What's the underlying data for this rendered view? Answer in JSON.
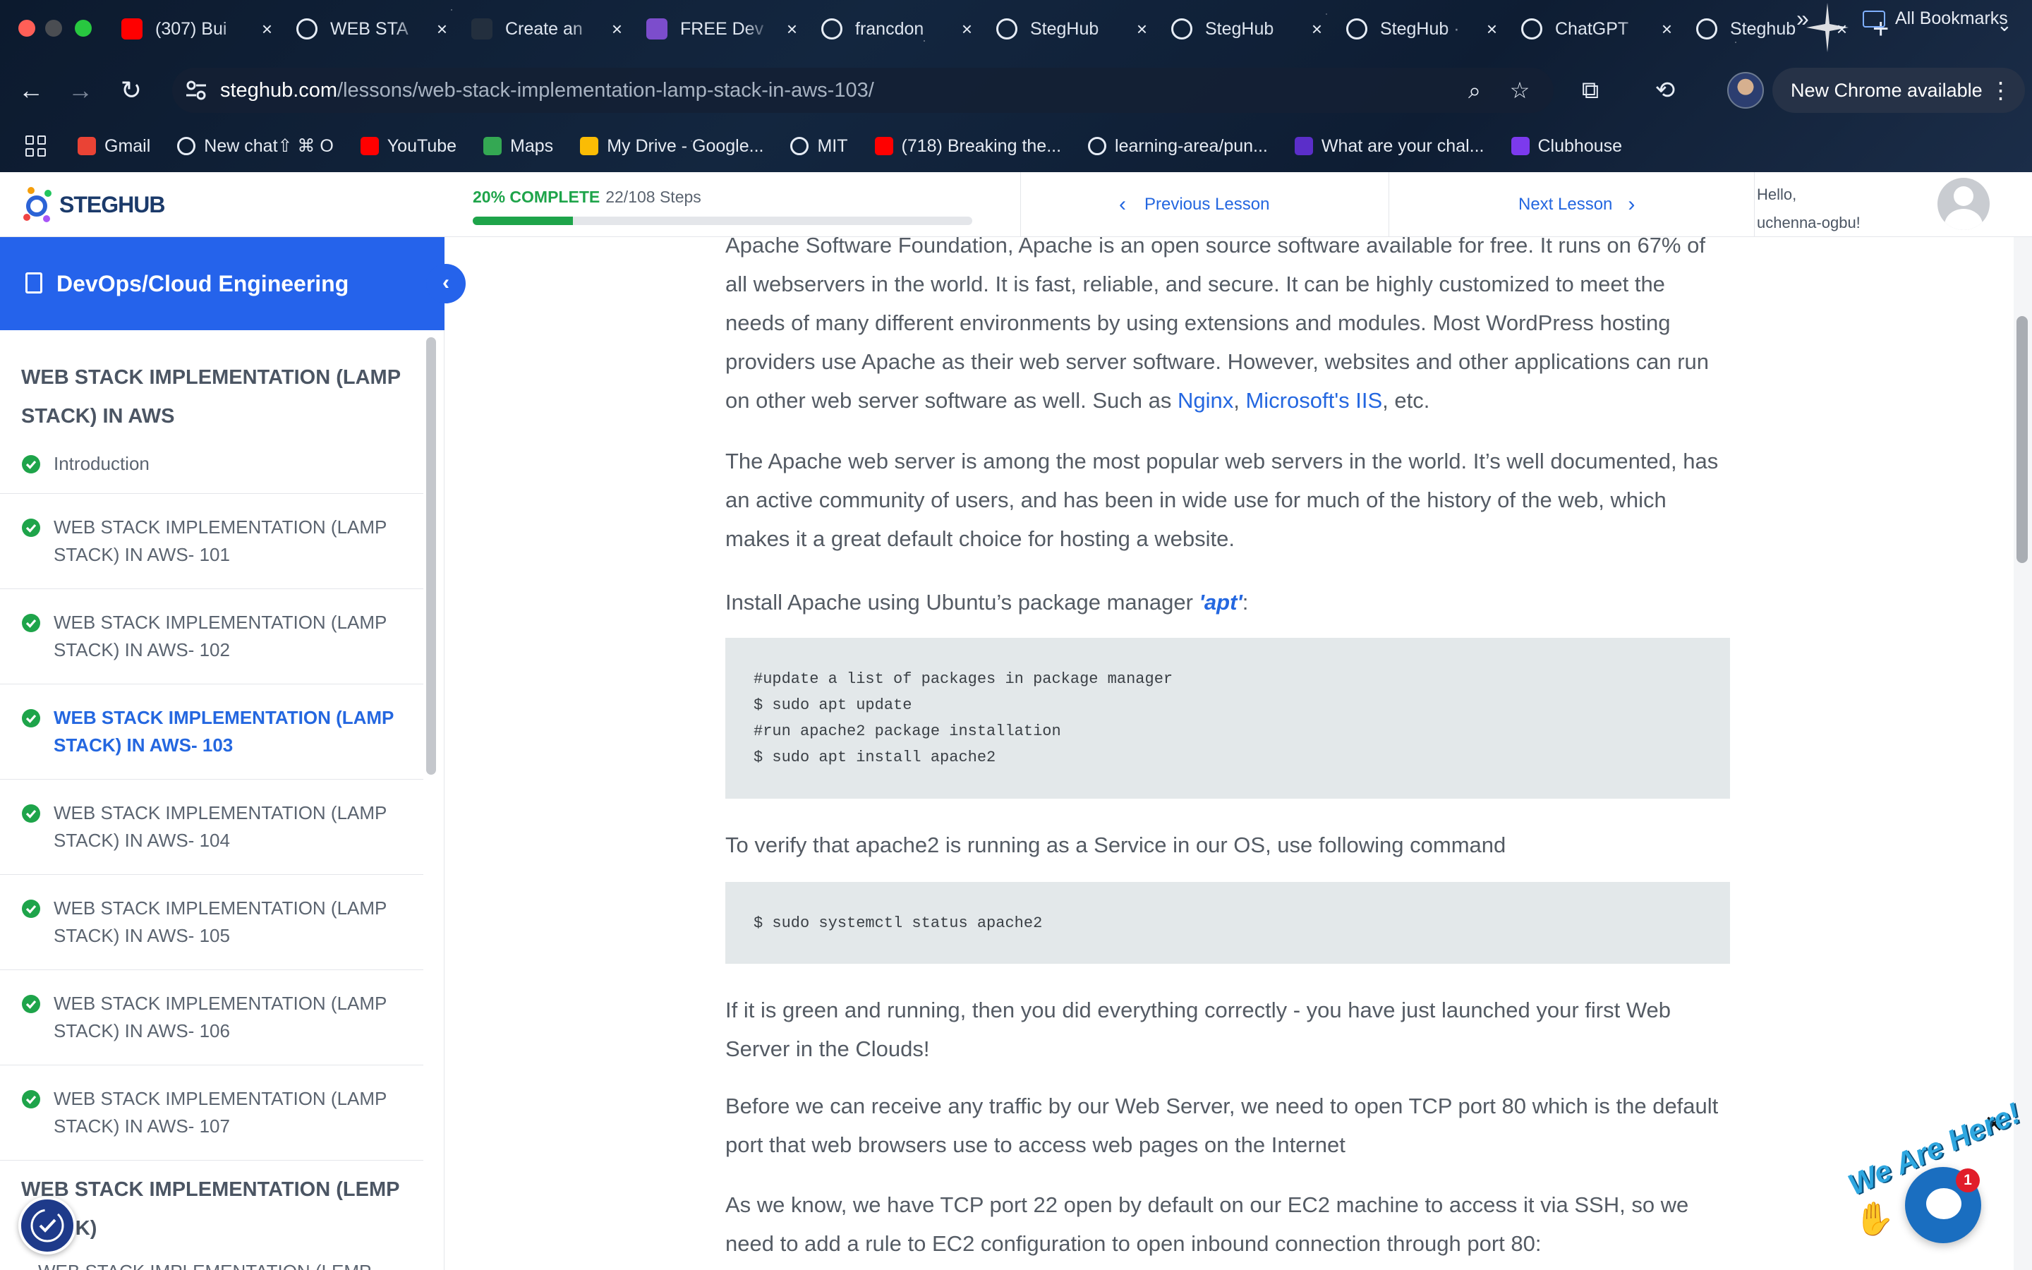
{
  "browser": {
    "tabs": [
      {
        "title": "(307) Bui",
        "icon": "youtube-icon",
        "color": "#ff0000"
      },
      {
        "title": "WEB STA",
        "icon": "steghub-icon",
        "color": "#ffffff"
      },
      {
        "title": "Create an",
        "icon": "aws-icon",
        "color": "#232f3e"
      },
      {
        "title": "FREE Dev",
        "icon": "forms-icon",
        "color": "#7c4dcc"
      },
      {
        "title": "francdon",
        "icon": "github-icon",
        "color": "#ffffff"
      },
      {
        "title": "StegHub",
        "icon": "github-icon",
        "color": "#ffffff"
      },
      {
        "title": "StegHub",
        "icon": "github-icon",
        "color": "#ffffff"
      },
      {
        "title": "StegHub ·",
        "icon": "globe-icon",
        "color": "#ffffff"
      },
      {
        "title": "ChatGPT",
        "icon": "chatgpt-icon",
        "color": "#ffffff"
      },
      {
        "title": "Steghub",
        "icon": "github-icon",
        "color": "#ffffff"
      }
    ],
    "url_domain": "steghub.com",
    "url_path": "/lessons/web-stack-implementation-lamp-stack-in-aws-103/",
    "update_label": "New Chrome available",
    "bookmarks": [
      {
        "label": "Gmail",
        "icon": "gmail-icon",
        "color": "#ea4335"
      },
      {
        "label": "New chat⇧ ⌘ O",
        "icon": "chatgpt-icon",
        "color": "#ffffff"
      },
      {
        "label": "YouTube",
        "icon": "youtube-icon",
        "color": "#ff0000"
      },
      {
        "label": "Maps",
        "icon": "maps-icon",
        "color": "#34a853"
      },
      {
        "label": "My Drive - Google...",
        "icon": "drive-icon",
        "color": "#fbbc04"
      },
      {
        "label": "MIT",
        "icon": "globe-icon",
        "color": "#ffffff"
      },
      {
        "label": "(718) Breaking the...",
        "icon": "youtube-icon",
        "color": "#ff0000"
      },
      {
        "label": "learning-area/pun...",
        "icon": "github-icon",
        "color": "#ffffff"
      },
      {
        "label": "What are your chal...",
        "icon": "bookmark-icon",
        "color": "#5b2ec9"
      },
      {
        "label": "Clubhouse",
        "icon": "clubhouse-icon",
        "color": "#7c3aed"
      }
    ],
    "all_bookmarks_label": "All Bookmarks"
  },
  "header": {
    "logo_text": "STEGHUB",
    "progress_percent_label": "20% COMPLETE",
    "progress_steps": "22/108 Steps",
    "progress_fraction": 0.2,
    "prev_label": "Previous Lesson",
    "next_label": "Next Lesson",
    "greeting": "Hello, uchenna-ogbu!"
  },
  "sidebar": {
    "course_title": "DevOps/Cloud Engineering",
    "sections": [
      {
        "title": "WEB STACK IMPLEMENTATION (LAMP STACK) IN AWS",
        "lessons": [
          {
            "label": "Introduction",
            "done": true,
            "active": false
          },
          {
            "label": "WEB STACK IMPLEMENTATION (LAMP STACK) IN AWS- 101",
            "done": true,
            "active": false
          },
          {
            "label": "WEB STACK IMPLEMENTATION (LAMP STACK) IN AWS- 102",
            "done": true,
            "active": false
          },
          {
            "label": "WEB STACK IMPLEMENTATION (LAMP STACK) IN AWS- 103",
            "done": true,
            "active": true
          },
          {
            "label": "WEB STACK IMPLEMENTATION (LAMP STACK) IN AWS- 104",
            "done": true,
            "active": false
          },
          {
            "label": "WEB STACK IMPLEMENTATION (LAMP STACK) IN AWS- 105",
            "done": true,
            "active": false
          },
          {
            "label": "WEB STACK IMPLEMENTATION (LAMP STACK) IN AWS- 106",
            "done": true,
            "active": false
          },
          {
            "label": "WEB STACK IMPLEMENTATION (LAMP STACK) IN AWS- 107",
            "done": true,
            "active": false
          }
        ]
      },
      {
        "title": "WEB STACK IMPLEMENTATION (LEMP STACK)",
        "lessons": [
          {
            "label": "WEB STACK IMPLEMENTATION (LEMP",
            "done": false,
            "active": false
          }
        ]
      }
    ]
  },
  "content": {
    "p1_text": "Apache Software Foundation, Apache is an open source software available for free. It runs on 67% of all webservers in the world. It is fast, reliable, and secure. It can be highly customized to meet the needs of many different environments by using extensions and modules. Most WordPress hosting providers use Apache as their web server software. However, websites and other applications can run on other web server software as well. Such as ",
    "p1_link1": "Nginx",
    "p1_sep": ", ",
    "p1_link2": "Microsoft's IIS",
    "p1_end": ", etc.",
    "p2": "The Apache web server is among the most popular web servers in the world. It’s well documented, has an active community of users, and has been in wide use for much of the history of the web, which makes it a great default choice for hosting a website.",
    "p3_text": "Install Apache using Ubuntu’s package manager ",
    "p3_code": "'apt'",
    "p3_end": ":",
    "code1": "#update a list of packages in package manager\n$ sudo apt update\n#run apache2 package installation\n$ sudo apt install apache2",
    "p4": "To verify that apache2 is running as a Service in our OS, use following command",
    "code2": "$ sudo systemctl status apache2",
    "p5": "If it is green and running, then you did everything correctly - you have just launched your first Web Server in the Clouds!",
    "p6": "Before we can receive any traffic by our Web Server, we need to open TCP port 80 which is the default port that web browsers use to access web pages on the Internet",
    "p7": "As we know, we have TCP port 22 open by default on our EC2 machine to access it via SSH, so we need to add a rule to EC2 configuration to open inbound connection through port 80:"
  },
  "chat": {
    "tagline": "We Are Here!",
    "badge_count": "1"
  }
}
